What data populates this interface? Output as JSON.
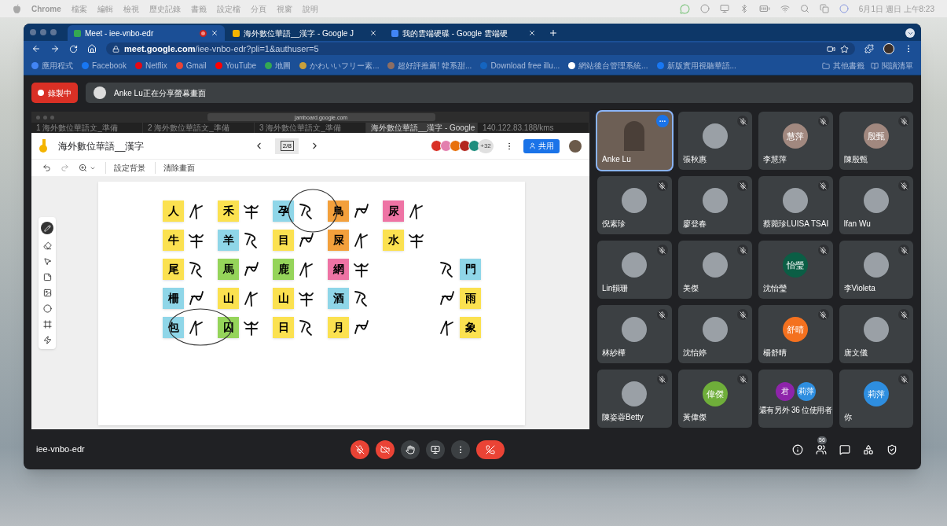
{
  "menubar": {
    "app": "Chrome",
    "menus": [
      "檔案",
      "編輯",
      "檢視",
      "歷史記錄",
      "書籤",
      "設定檔",
      "分頁",
      "視窗",
      "說明"
    ],
    "clock": "6月1日 週日 上午8:23"
  },
  "browser": {
    "tabs": [
      {
        "title": "Meet - iee-vnbo-edr",
        "selected": true,
        "recording": true
      },
      {
        "title": "海外數位華語__漢字 - Google J",
        "selected": false,
        "recording": false
      },
      {
        "title": "我的雲端硬碟 - Google 雲端硬",
        "selected": false,
        "recording": false
      }
    ],
    "url_host": "meet.google.com",
    "url_path": "/iee-vnbo-edr?pli=1&authuser=5",
    "bookmarks": [
      {
        "label": "應用程式",
        "color": "#4285f4"
      },
      {
        "label": "Facebook",
        "color": "#1877f2"
      },
      {
        "label": "Netflix",
        "color": "#e50914"
      },
      {
        "label": "Gmail",
        "color": "#ea4335"
      },
      {
        "label": "YouTube",
        "color": "#ff0000"
      },
      {
        "label": "地圖",
        "color": "#34a853"
      },
      {
        "label": "かわいいフリー素...",
        "color": "#c8a03c"
      },
      {
        "label": "超好評推薦! 韓系甜...",
        "color": "#8d6e63"
      },
      {
        "label": "Download free illu...",
        "color": "#1565c0"
      },
      {
        "label": "網站後台管理系統...",
        "color": "#ffffff"
      },
      {
        "label": "新版實用視聽華語...",
        "color": "#1877f2"
      }
    ],
    "bookmarks_right": [
      "其他書籤",
      "閱讀清單"
    ]
  },
  "meet": {
    "recording_label": "錄製中",
    "share_notice": "Anke Lu正在分享螢幕畫面",
    "shared_screen": {
      "address": "jamboard.google.com",
      "tabs": [
        {
          "title": "1 海外數位華語文_準備",
          "selected": false
        },
        {
          "title": "2 海外數位華語文_準備",
          "selected": false
        },
        {
          "title": "3 海外數位華語文_準備",
          "selected": false
        },
        {
          "title": "海外數位華語__漢字 - Google",
          "selected": true
        },
        {
          "title": "140.122.83.188/kms",
          "selected": false
        }
      ],
      "title": "海外數位華語__漢字",
      "frame": "2/8",
      "collaborators": [
        {
          "color": "#d93025"
        },
        {
          "color": "#e37fae"
        },
        {
          "color": "#e8710a"
        },
        {
          "color": "#b3261e"
        },
        {
          "color": "#1e8e7e"
        }
      ],
      "collaborators_more": "+32",
      "share": "共用",
      "tools": [
        "設定背景",
        "清除畫面"
      ],
      "rows": [
        [
          {
            "char": "人",
            "color": "#fbe150"
          },
          {
            "char": "禾",
            "color": "#fbe150"
          },
          {
            "char": "孕",
            "color": "#8fd6e8"
          },
          {
            "char": "鳥",
            "color": "#f3a03c"
          },
          {
            "char": "尿",
            "color": "#ee73a4"
          }
        ],
        [
          {
            "char": "牛",
            "color": "#fbe150"
          },
          {
            "char": "羊",
            "color": "#8fd6e8"
          },
          {
            "char": "目",
            "color": "#fbe150"
          },
          {
            "char": "屎",
            "color": "#f3a03c"
          },
          {
            "char": "水",
            "color": "#fbe150"
          }
        ],
        [
          {
            "char": "尾",
            "color": "#fbe150"
          },
          {
            "char": "馬",
            "color": "#95d45a"
          },
          {
            "char": "鹿",
            "color": "#95d45a"
          },
          {
            "char": "網",
            "color": "#ee73a4"
          },
          {
            "char": "門",
            "color": "#8fd6e8"
          }
        ],
        [
          {
            "char": "柵",
            "color": "#8fd6e8"
          },
          {
            "char": "山",
            "color": "#fbe150"
          },
          {
            "char": "山",
            "color": "#fbe150"
          },
          {
            "char": "酒",
            "color": "#8fd6e8"
          },
          {
            "char": "雨",
            "color": "#fbe150"
          }
        ],
        [
          {
            "char": "包",
            "color": "#8fd6e8"
          },
          {
            "char": "囚",
            "color": "#95d45a"
          },
          {
            "char": "日",
            "color": "#fbe150"
          },
          {
            "char": "月",
            "color": "#fbe150"
          },
          {
            "char": "象",
            "color": "#fbe150"
          }
        ]
      ]
    },
    "participants": [
      {
        "name": "Anke Lu",
        "kind": "video",
        "muted": false,
        "highlighted": true
      },
      {
        "name": "張秋惠",
        "kind": "photo",
        "muted": true,
        "highlighted": false
      },
      {
        "name": "李慧萍",
        "kind": "initials",
        "initials": "慧萍",
        "color": "#a1887f",
        "muted": true,
        "highlighted": false
      },
      {
        "name": "陳殷甄",
        "kind": "initials",
        "initials": "殷甄",
        "color": "#a1887f",
        "muted": true,
        "highlighted": false
      },
      {
        "name": "倪素珍",
        "kind": "photo",
        "muted": true,
        "highlighted": false
      },
      {
        "name": "廖登春",
        "kind": "photo",
        "muted": true,
        "highlighted": false
      },
      {
        "name": "蔡菀珍LUISA TSAI",
        "kind": "photo",
        "muted": true,
        "highlighted": false
      },
      {
        "name": "Ifan Wu",
        "kind": "photo",
        "muted": true,
        "highlighted": false
      },
      {
        "name": "Lin韻珊",
        "kind": "photo",
        "muted": true,
        "highlighted": false
      },
      {
        "name": "美傑",
        "kind": "photo",
        "muted": true,
        "highlighted": false
      },
      {
        "name": "沈怡瑩",
        "kind": "initials",
        "initials": "怡瑩",
        "color": "#0b5e45",
        "muted": true,
        "highlighted": false
      },
      {
        "name": "李Violeta",
        "kind": "photo",
        "muted": true,
        "highlighted": false
      },
      {
        "name": "林紗樺",
        "kind": "photo",
        "muted": true,
        "highlighted": false
      },
      {
        "name": "沈怡婷",
        "kind": "photo",
        "muted": true,
        "highlighted": false
      },
      {
        "name": "楊舒晴",
        "kind": "initials",
        "initials": "舒晴",
        "color": "#f4711f",
        "muted": true,
        "highlighted": false
      },
      {
        "name": "唐文儀",
        "kind": "photo",
        "muted": true,
        "highlighted": false
      },
      {
        "name": "陳姿蓉Betty",
        "kind": "photo",
        "muted": true,
        "highlighted": false
      },
      {
        "name": "黃偉傑",
        "kind": "initials",
        "initials": "偉傑",
        "color": "#6fae3a",
        "muted": true,
        "highlighted": false
      },
      {
        "name": "還有另外 36 位使用者",
        "kind": "others",
        "muted": false,
        "highlighted": false,
        "mini": [
          {
            "initials": "君",
            "color": "#8e24aa"
          },
          {
            "initials": "莉萍",
            "color": "#2e8ee0"
          }
        ]
      },
      {
        "name": "你",
        "kind": "initials",
        "initials": "莉萍",
        "color": "#2e8ee0",
        "muted": true,
        "highlighted": false
      }
    ],
    "meeting_code": "iee-vnbo-edr",
    "people_count": "56"
  }
}
